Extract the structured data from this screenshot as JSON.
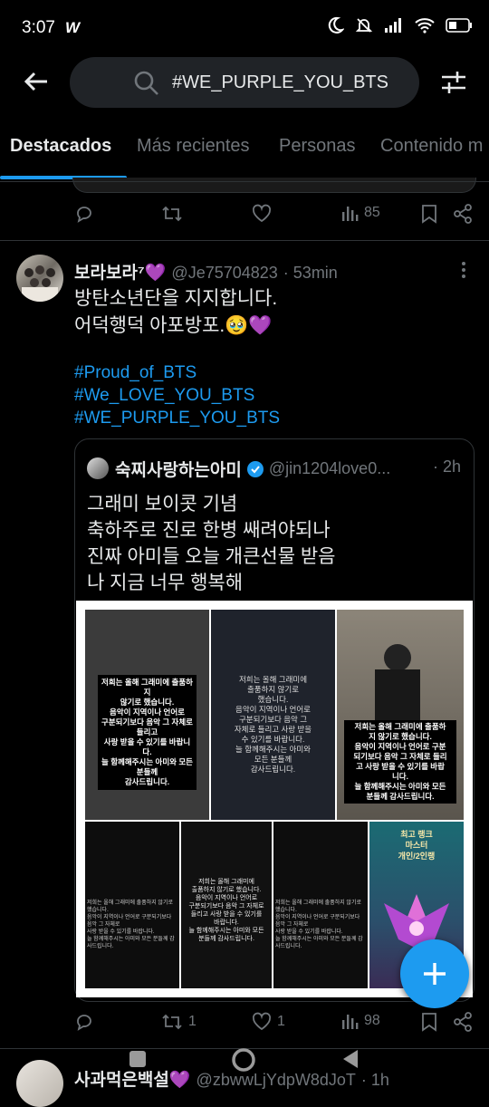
{
  "status_bar": {
    "time": "3:07",
    "app_icon": "W"
  },
  "search": {
    "query": "#WE_PURPLE_YOU_BTS"
  },
  "tabs": [
    {
      "label": "Destacados",
      "active": true
    },
    {
      "label": "Más recientes",
      "active": false
    },
    {
      "label": "Personas",
      "active": false
    },
    {
      "label": "Contenido m",
      "active": false
    }
  ],
  "prev_tweet": {
    "views": "85"
  },
  "tweet": {
    "name": "보라보라⁷💜",
    "handle": "@Je75704823",
    "time": "· 53min",
    "line1": "방탄소년단을 지지합니다.",
    "line2": "어덕행덕 아포방포.🥹💜",
    "hashtags": [
      "#Proud_of_BTS",
      "#We_LOVE_YOU_BTS",
      "#WE_PURPLE_YOU_BTS"
    ],
    "quote": {
      "name": "숙찌사랑하는아미",
      "handle": "@jin1204love0...",
      "time": "· 2h",
      "lines": [
        "그래미 보이콧 기념",
        "축하주로 진로 한병 쌔려야되나",
        "진짜 아미들 오늘 개큰선물 받음",
        "나 지금 너무 행복해"
      ],
      "image_text_1": "저희는 올해 그래미에 출품하지\n않기로 했습니다.\n음악이 지역이나 언어로\n구분되기보다 음악 그 자체로 들리고\n사랑 받을 수 있기를 바랍니다.\n늘 함께해주시는 아미와 모든 분들께\n감사드립니다.",
      "image_text_2": "저희는 올해 그래미에\n출품하지 않기로\n했습니다.\n음악이 지역이나 언어로\n구분되기보다 음악 그\n자체로 들리고 사랑 받을\n수 있기를 바랍니다.\n늘 함께해주시는 아미와\n모든 분들께\n감사드립니다.",
      "image_text_3": "저희는 올해 그래미에 출품하\n지 않기로 했습니다.\n음악이 지역이나 언어로 구분\n되기보다 음악 그 자체로 들리\n고 사랑 받을 수 있기를 바랍\n니다.\n늘 함께해주시는 아미와 모든\n분들께 감사드립니다.",
      "image_text_4": "저희는 올해 그래미에 출품하지 않기로 했습니다.\n음악이 지역이나 언어로 구분되기보다 음악 그 자체로\n사랑 받을 수 있기를 바랍니다.\n늘 함께해주시는 아미와 모든 분들께 감사드립니다.",
      "image_text_5": "저희는 올해 그래미에\n출품하지 않기로 했습니다.\n음악이 지역이나 언어로\n구분되기보다 음악 그 자체로\n들리고 사랑 받을 수 있기를\n바랍니다.\n늘 함께해주시는 아미와 모든\n분들께 감사드립니다.",
      "image_text_6": "저희는 올해 그래미에 출품하지 않기로 했습니다.\n음악이 지역이나 언어로 구분되기보다 음악 그 자체로\n사랑 받을 수 있기를 바랍니다.\n늘 함께해주시는 아미와 모든 분들께 감사드립니다.",
      "image_text_7": "최고 랭크\n마스터\n개인/2인랭"
    },
    "retweets": "1",
    "likes": "1",
    "views": "98"
  },
  "next_tweet": {
    "name": "사과먹은백설💜",
    "handle": "@zbwwLjYdpW8dJoT",
    "time": "· 1h"
  },
  "colors": {
    "accent": "#1d9bf0",
    "background": "#000000",
    "muted": "#71767b",
    "purple": "#a855f7"
  }
}
